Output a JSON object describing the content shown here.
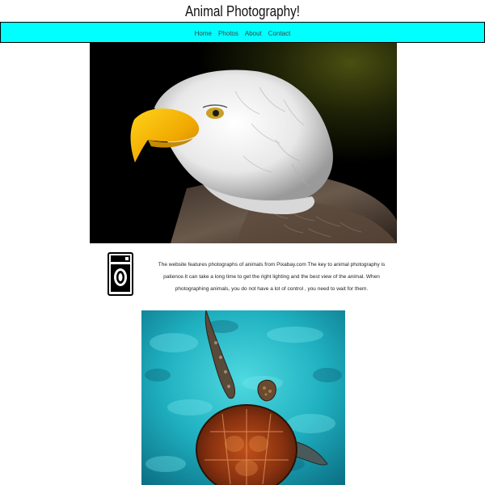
{
  "header": {
    "title": "Animal Photography!"
  },
  "nav": {
    "items": [
      "Home",
      "Photos",
      "About",
      "Contact"
    ]
  },
  "hero": {
    "subject": "bald eagle photo"
  },
  "intro": {
    "icon": "camera-icon",
    "text": "The website features photographs of animals from Pixabay.com The key to animal photography is patience.It can take a long time to get the right lighting and the best view of the animal. When photographing animals, you do not have a lot of control , you need to wait for them."
  },
  "gallery": {
    "second_image_subject": "sea turtle photo"
  },
  "colors": {
    "nav_background": "#00ffff",
    "page_background": "#ffffff"
  }
}
